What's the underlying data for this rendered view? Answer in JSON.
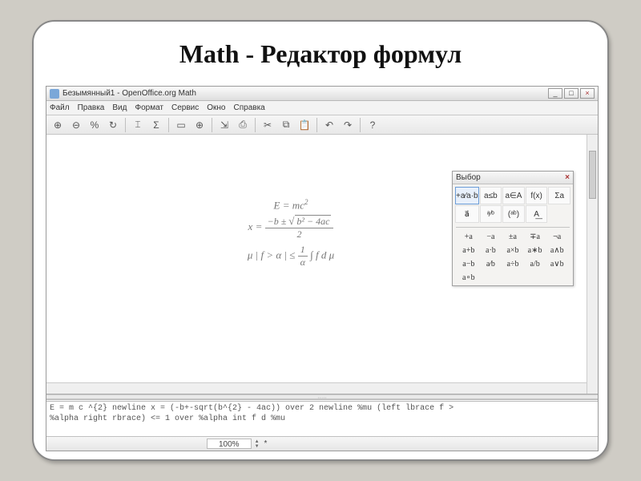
{
  "slide": {
    "title": "Math - Редактор формул"
  },
  "window": {
    "title": "Безымянный1 - OpenOffice.org Math",
    "controls": {
      "min": "_",
      "max": "□",
      "close": "×"
    }
  },
  "menu": {
    "items": [
      "Файл",
      "Правка",
      "Вид",
      "Формат",
      "Сервис",
      "Окно",
      "Справка"
    ]
  },
  "toolbar": {
    "buttons": [
      {
        "name": "zoom-in-icon",
        "glyph": "⊕"
      },
      {
        "name": "zoom-out-icon",
        "glyph": "⊖"
      },
      {
        "name": "zoom-100-icon",
        "glyph": "%"
      },
      {
        "name": "refresh-icon",
        "glyph": "↻"
      },
      {
        "name": "sep",
        "glyph": "|"
      },
      {
        "name": "formula-icon",
        "glyph": "⌶"
      },
      {
        "name": "sigma-icon",
        "glyph": "Σ"
      },
      {
        "name": "sep",
        "glyph": "|"
      },
      {
        "name": "field-icon",
        "glyph": "▭"
      },
      {
        "name": "symbol-icon",
        "glyph": "⊕"
      },
      {
        "name": "sep",
        "glyph": "|"
      },
      {
        "name": "export-icon",
        "glyph": "⇲"
      },
      {
        "name": "print-icon",
        "glyph": "⎙"
      },
      {
        "name": "sep",
        "glyph": "|"
      },
      {
        "name": "cut-icon",
        "glyph": "✂"
      },
      {
        "name": "copy-icon",
        "glyph": "⧉"
      },
      {
        "name": "paste-icon",
        "glyph": "📋"
      },
      {
        "name": "sep",
        "glyph": "|"
      },
      {
        "name": "undo-icon",
        "glyph": "↶"
      },
      {
        "name": "redo-icon",
        "glyph": "↷"
      },
      {
        "name": "sep",
        "glyph": "|"
      },
      {
        "name": "help-icon",
        "glyph": "?"
      }
    ]
  },
  "formula": {
    "line1_lhs": "E",
    "line1_eq": " = ",
    "line1_rhs": "mc",
    "line1_exp": "2",
    "line2_lhs": "x = ",
    "line2_num_a": "−b ± ",
    "line2_num_rad": "b² − 4ac",
    "line2_den": "2",
    "line3_a": "μ | f > α | ≤ ",
    "line3_num": "1",
    "line3_den": "α",
    "line3_b": " ∫ f d μ"
  },
  "elements": {
    "title": "Выбор",
    "close": "×",
    "cats": [
      {
        "g": "+a⁄a·b",
        "sel": true
      },
      {
        "g": "a≤b"
      },
      {
        "g": "a∈A"
      },
      {
        "g": "f(x)"
      },
      {
        "g": "Σa"
      },
      {
        "g": "a⃗"
      },
      {
        "g": "ᵃ⁄ᵇ"
      },
      {
        "g": "(ᵃᵇ)"
      },
      {
        "g": "A͟"
      }
    ],
    "ops": [
      "+a",
      "−a",
      "±a",
      "∓a",
      "¬a",
      "a+b",
      "a·b",
      "a×b",
      "a∗b",
      "a∧b",
      "a−b",
      "a⁄b",
      "a÷b",
      "a/b",
      "a∨b",
      "a∘b",
      "",
      "",
      "",
      ""
    ]
  },
  "code": {
    "line1": "E = m c ^{2} newline x = (-b+-sqrt(b^{2} - 4ac)) over 2 newline %mu (left lbrace f >",
    "line2": "%alpha right rbrace) <= 1 over %alpha int f d %mu"
  },
  "status": {
    "zoom": "100%",
    "modified": "*"
  }
}
